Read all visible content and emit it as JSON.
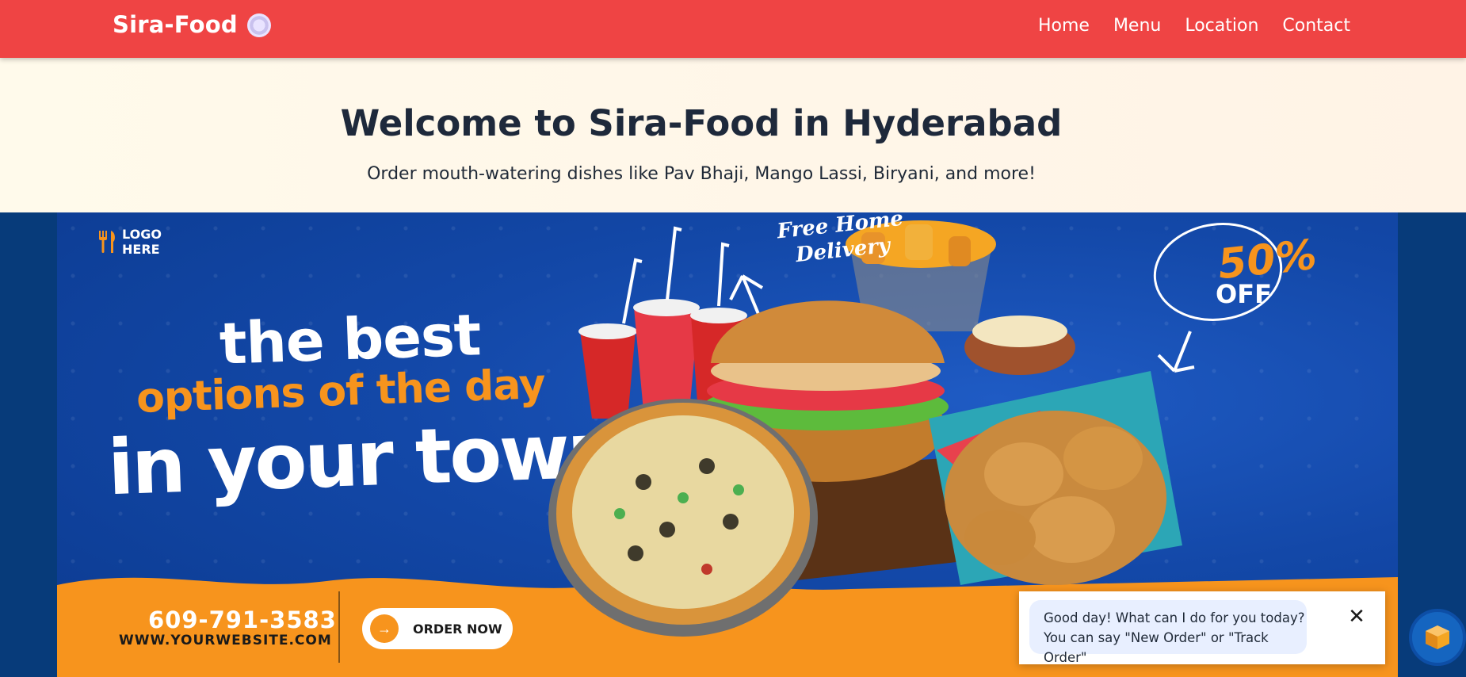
{
  "navbar": {
    "brand": "Sira-Food",
    "brand_icon": "plate-icon",
    "links": [
      "Home",
      "Menu",
      "Location",
      "Contact"
    ],
    "bg_color": "#ef4444"
  },
  "hero": {
    "title": "Welcome to Sira-Food in Hyderabad",
    "subtitle": "Order mouth-watering dishes like Pav Bhaji, Mango Lassi, Biryani, and more!"
  },
  "banner": {
    "logo_line1": "LOGO",
    "logo_line2": "HERE",
    "tagline_1": "the best",
    "tagline_2": "options of the day",
    "tagline_3": "in your town",
    "free_delivery_1": "Free Home",
    "free_delivery_2": "Delivery",
    "discount_value": "50%",
    "discount_label": "OFF",
    "phone": "609-791-3583",
    "website": "WWW.YOURWEBSITE.COM",
    "order_button": "ORDER NOW",
    "accent_color": "#f7941d",
    "bg_color": "#1348a8"
  },
  "chat": {
    "line1": "Good day! What can I do for you today?",
    "line2": "You can say \"New Order\" or \"Track Order\"",
    "close_icon": "close-icon",
    "launcher_icon": "cube-icon"
  }
}
